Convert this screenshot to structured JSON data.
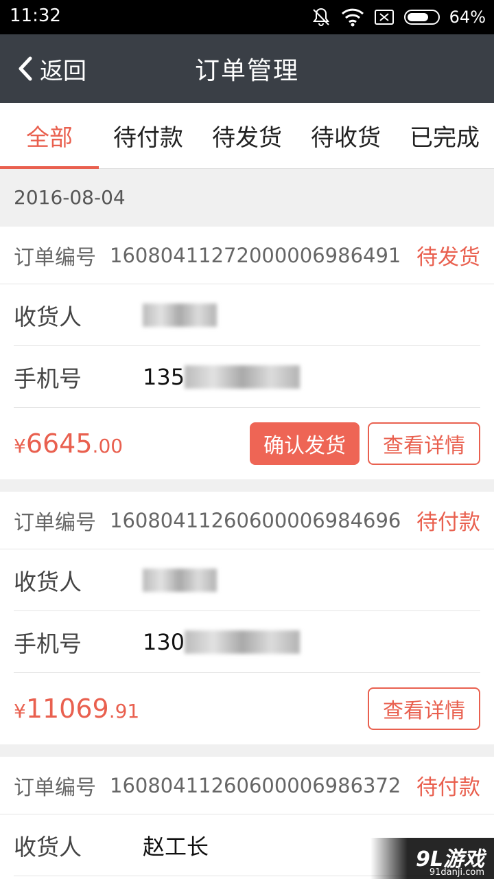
{
  "status_bar": {
    "time": "11:32",
    "battery": "64%"
  },
  "header": {
    "back_label": "返回",
    "title": "订单管理"
  },
  "tabs": [
    {
      "label": "全部",
      "active": true
    },
    {
      "label": "待付款",
      "active": false
    },
    {
      "label": "待发货",
      "active": false
    },
    {
      "label": "待收货",
      "active": false
    },
    {
      "label": "已完成",
      "active": false
    }
  ],
  "date_header": "2016-08-04",
  "labels": {
    "order_no": "订单编号",
    "receiver": "收货人",
    "phone": "手机号"
  },
  "orders": [
    {
      "order_no": "16080411272000006986491",
      "status": "待发货",
      "receiver": "",
      "phone_prefix": "135",
      "price_symbol": "¥",
      "price_int": "6645",
      "price_dec": ".00",
      "confirm_button": "确认发货",
      "detail_button": "查看详情"
    },
    {
      "order_no": "16080411260600006984696",
      "status": "待付款",
      "receiver": "",
      "phone_prefix": "130",
      "price_symbol": "¥",
      "price_int": "11069",
      "price_dec": ".91",
      "detail_button": "查看详情"
    },
    {
      "order_no": "16080411260600006986372",
      "status": "待付款",
      "receiver": "赵工长"
    }
  ],
  "watermark": {
    "main": "9L游戏",
    "sub": "91danji.com"
  },
  "colors": {
    "accent": "#e9604f",
    "header_bg": "#3a3f46",
    "button_fill": "#ee6555"
  }
}
